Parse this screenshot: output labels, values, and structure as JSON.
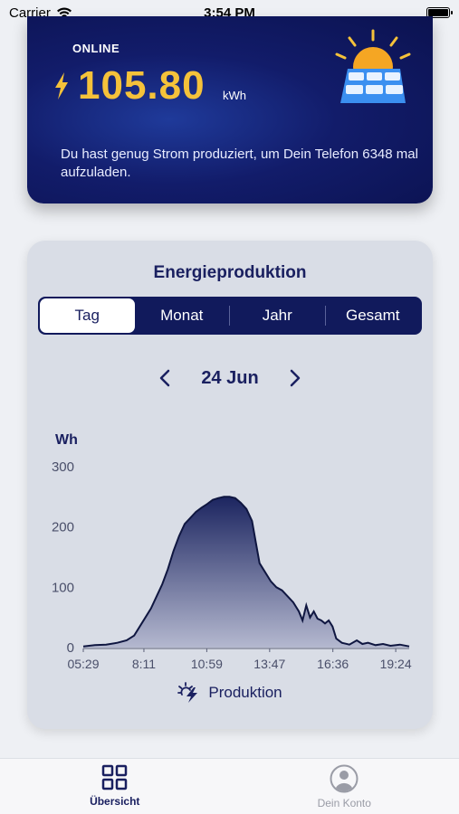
{
  "status_bar": {
    "carrier": "Carrier",
    "time": "3:54 PM"
  },
  "energy": {
    "status": "ONLINE",
    "value": "105.80",
    "unit": "kWh",
    "message": "Du hast genug Strom produziert, um Dein Telefon 6348 mal aufzuladen.",
    "accent_color": "#f5c23a"
  },
  "production": {
    "title": "Energieproduktion",
    "tabs": [
      {
        "label": "Tag",
        "active": true
      },
      {
        "label": "Monat",
        "active": false
      },
      {
        "label": "Jahr",
        "active": false
      },
      {
        "label": "Gesamt",
        "active": false
      }
    ],
    "date": "24 Jun",
    "legend_label": "Produktion"
  },
  "chart_data": {
    "type": "area",
    "ylabel": "Wh",
    "ylim": [
      0,
      300
    ],
    "y_ticks": [
      "300",
      "200",
      "100",
      "0"
    ],
    "x_ticks": [
      "05:29",
      "8:11",
      "10:59",
      "13:47",
      "16:36",
      "19:24"
    ],
    "x_tick_minutes": [
      329,
      491,
      659,
      827,
      996,
      1164
    ],
    "xlim_minutes": [
      329,
      1200
    ],
    "series": [
      {
        "name": "Produktion",
        "points": [
          [
            329,
            2
          ],
          [
            360,
            4
          ],
          [
            390,
            5
          ],
          [
            420,
            8
          ],
          [
            445,
            12
          ],
          [
            465,
            20
          ],
          [
            480,
            35
          ],
          [
            495,
            50
          ],
          [
            510,
            65
          ],
          [
            525,
            85
          ],
          [
            540,
            105
          ],
          [
            555,
            130
          ],
          [
            570,
            160
          ],
          [
            585,
            185
          ],
          [
            600,
            205
          ],
          [
            615,
            215
          ],
          [
            630,
            225
          ],
          [
            645,
            232
          ],
          [
            660,
            238
          ],
          [
            675,
            245
          ],
          [
            690,
            248
          ],
          [
            705,
            250
          ],
          [
            720,
            250
          ],
          [
            735,
            248
          ],
          [
            750,
            240
          ],
          [
            765,
            230
          ],
          [
            780,
            210
          ],
          [
            790,
            175
          ],
          [
            800,
            140
          ],
          [
            815,
            125
          ],
          [
            830,
            110
          ],
          [
            845,
            100
          ],
          [
            860,
            95
          ],
          [
            875,
            85
          ],
          [
            890,
            75
          ],
          [
            905,
            60
          ],
          [
            915,
            45
          ],
          [
            925,
            70
          ],
          [
            935,
            50
          ],
          [
            945,
            60
          ],
          [
            955,
            48
          ],
          [
            965,
            45
          ],
          [
            975,
            40
          ],
          [
            985,
            45
          ],
          [
            995,
            35
          ],
          [
            1005,
            15
          ],
          [
            1020,
            8
          ],
          [
            1040,
            5
          ],
          [
            1060,
            12
          ],
          [
            1075,
            6
          ],
          [
            1090,
            8
          ],
          [
            1110,
            4
          ],
          [
            1130,
            6
          ],
          [
            1150,
            3
          ],
          [
            1175,
            5
          ],
          [
            1200,
            2
          ]
        ]
      }
    ],
    "grid": false
  },
  "tab_bar": {
    "items": [
      {
        "label": "Übersicht",
        "icon": "grid-icon",
        "active": true
      },
      {
        "label": "Dein Konto",
        "icon": "account-icon",
        "active": false
      }
    ]
  }
}
